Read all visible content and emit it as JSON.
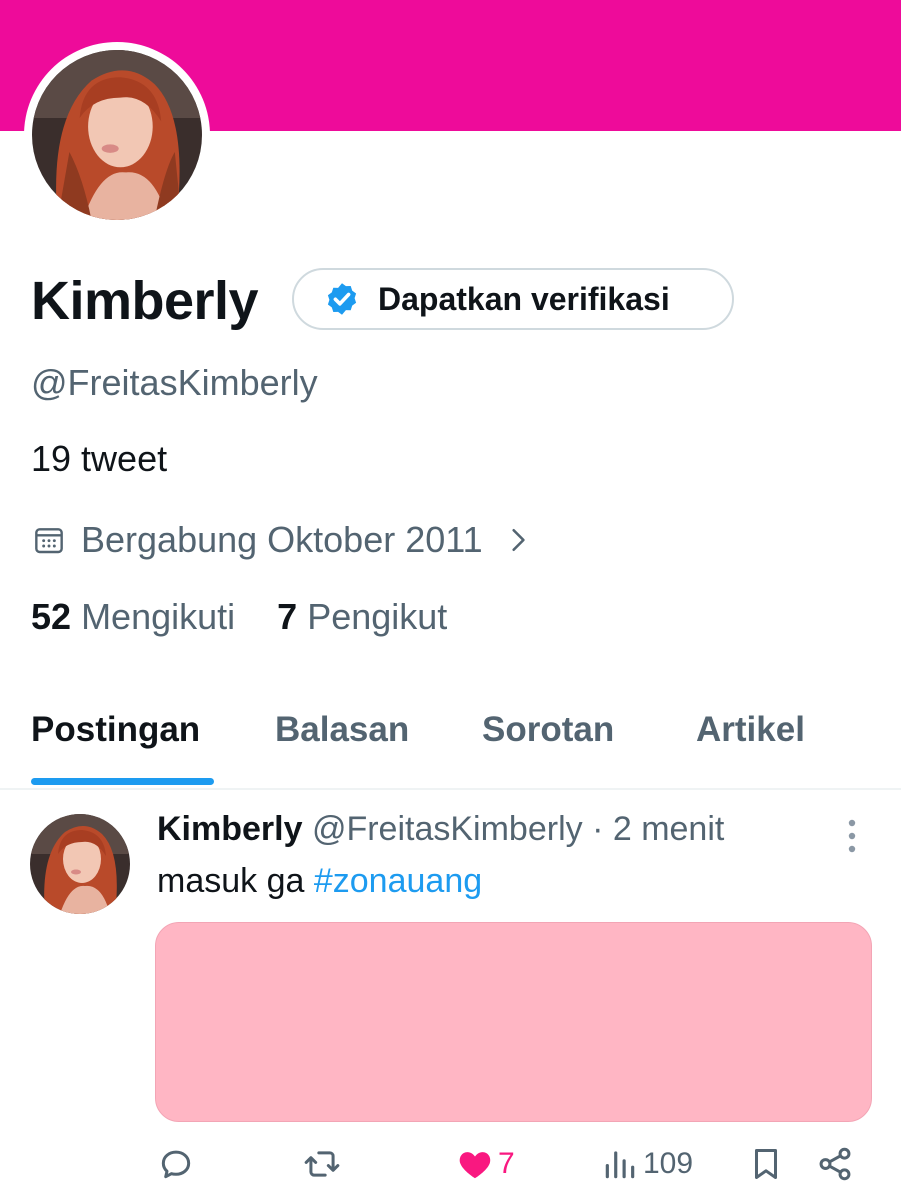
{
  "profile": {
    "banner_color": "#ee0b9a",
    "name": "Kimberly",
    "verify_label": "Dapatkan verifikasi",
    "handle": "@FreitasKimberly",
    "tweet_count": "19 tweet",
    "joined": "Bergabung Oktober 2011",
    "following_count": "52",
    "following_label": "Mengikuti",
    "followers_count": "7",
    "followers_label": "Pengikut"
  },
  "tabs": [
    {
      "label": "Postingan",
      "active": true
    },
    {
      "label": "Balasan",
      "active": false
    },
    {
      "label": "Sorotan",
      "active": false
    },
    {
      "label": "Artikel",
      "active": false
    }
  ],
  "post": {
    "name": "Kimberly",
    "handle": "@FreitasKimberly",
    "time": "· 2 menit",
    "text": "masuk ga",
    "hashtag": "#zonauang",
    "media_color": "#ffb6c4",
    "actions": {
      "reply_icon": "reply-icon",
      "retweet_icon": "retweet-icon",
      "like_icon": "heart-icon",
      "like_count": "7",
      "views_icon": "views-icon",
      "views_count": "109",
      "bookmark_icon": "bookmark-icon",
      "share_icon": "share-icon"
    }
  },
  "colors": {
    "accent": "#1d9bf0",
    "like": "#f91880",
    "muted": "#536471"
  }
}
